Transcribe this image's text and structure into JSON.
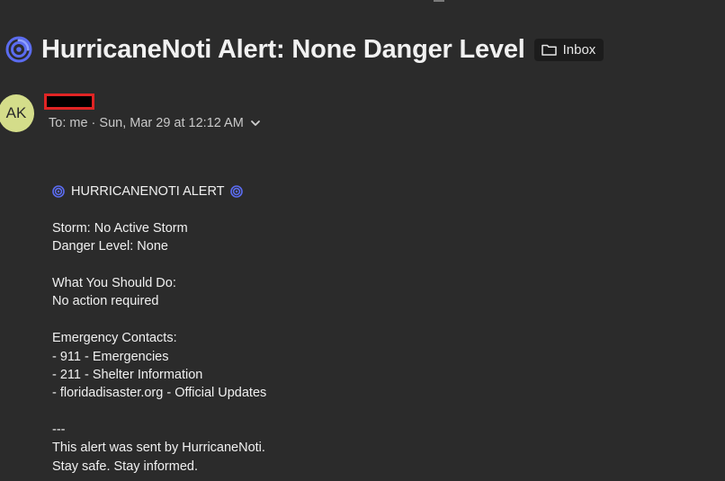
{
  "email": {
    "subject": "HurricaneNoti Alert: None Danger Level",
    "label": "Inbox",
    "sender": {
      "avatar_initials": "AK",
      "name_redacted": true
    },
    "recipient_line": "To: me · Sun, Mar 29 at 12:12 AM"
  },
  "body": {
    "alert_title": "HURRICANENOTI ALERT",
    "storm": "Storm: No Active Storm",
    "danger_level": "Danger Level: None",
    "what_to_do_heading": "What You Should Do:",
    "what_to_do": "No action required",
    "contacts_heading": "Emergency Contacts:",
    "contacts": [
      "- 911 - Emergencies",
      "- 211 - Shelter Information",
      "- floridadisaster.org - Official Updates"
    ],
    "divider": "---",
    "footer_sent_by": "This alert was sent by HurricaneNoti.",
    "footer_tagline": "Stay safe. Stay informed."
  },
  "icons": {
    "cyclone": "cyclone-icon",
    "folder": "folder-icon",
    "chevron": "chevron-down-icon"
  },
  "colors": {
    "background": "#2b2b2b",
    "avatar": "#d4dd8a",
    "cyclone": "#5b6cf0",
    "redaction_border": "#e02424"
  }
}
